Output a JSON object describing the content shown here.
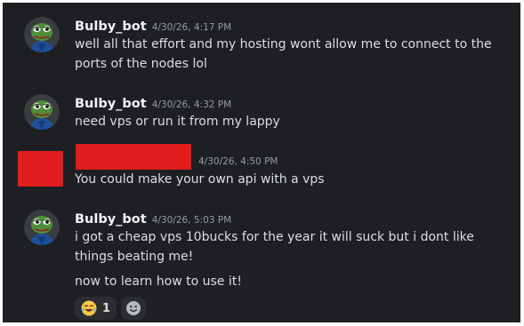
{
  "colors": {
    "background": "#1e1f22",
    "username": "#f2f3f5",
    "text": "#dbdee1",
    "timestamp": "#949ba4",
    "redaction": "#e11d1d"
  },
  "messages": [
    {
      "author": "Bulby_bot",
      "timestamp": "4/30/26, 4:17 PM",
      "avatar_icon": "pepe-avatar-icon",
      "lines": [
        "well all that effort and my hosting wont allow me to connect to the ports of the nodes lol"
      ]
    },
    {
      "author": "Bulby_bot",
      "timestamp": "4/30/26, 4:32 PM",
      "avatar_icon": "pepe-avatar-icon",
      "lines": [
        "need vps or run it from my lappy"
      ]
    },
    {
      "author_redacted": true,
      "timestamp": "4/30/26, 4:50 PM",
      "lines": [
        "You could make your own api with a vps"
      ]
    },
    {
      "author": "Bulby_bot",
      "timestamp": "4/30/26, 5:03 PM",
      "avatar_icon": "pepe-avatar-icon",
      "lines": [
        "i got a cheap vps 10bucks for the year it will suck but i dont like things beating me!",
        "now to learn how to use it!"
      ],
      "reactions": [
        {
          "emoji_icon": "joy-emoji-icon",
          "count": "1"
        }
      ],
      "add_reaction_icon": "smile-icon"
    }
  ]
}
